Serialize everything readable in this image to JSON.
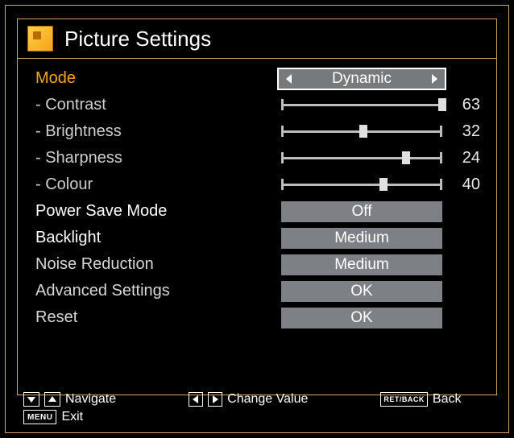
{
  "header": {
    "title": "Picture Settings"
  },
  "mode": {
    "label": "Mode",
    "value": "Dynamic"
  },
  "sliders": {
    "contrast": {
      "label": "- Contrast",
      "value": 63,
      "max": 63
    },
    "brightness": {
      "label": "- Brightness",
      "value": 32,
      "max": 63
    },
    "sharpness": {
      "label": "- Sharpness",
      "value": 24,
      "max": 31
    },
    "colour": {
      "label": "- Colour",
      "value": 40,
      "max": 63
    }
  },
  "options": {
    "powerSave": {
      "label": "Power Save Mode",
      "value": "Off"
    },
    "backlight": {
      "label": "Backlight",
      "value": "Medium"
    },
    "noiseReduction": {
      "label": "Noise Reduction",
      "value": "Medium"
    },
    "advancedSettings": {
      "label": "Advanced Settings",
      "value": "OK"
    },
    "reset": {
      "label": "Reset",
      "value": "OK"
    }
  },
  "footer": {
    "navigate": "Navigate",
    "change": "Change Value",
    "back": "Back",
    "exit": "Exit",
    "retback": "RET/BACK",
    "menu": "MENU"
  }
}
